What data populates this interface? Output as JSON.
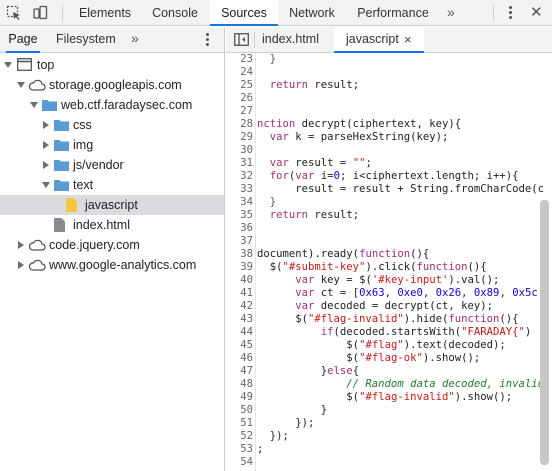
{
  "toolbar": {
    "tabs": [
      "Elements",
      "Console",
      "Sources",
      "Network",
      "Performance"
    ],
    "active_tab": "Sources",
    "more": "»"
  },
  "navigator": {
    "tabs": [
      "Page",
      "Filesystem"
    ],
    "active_tab": "Page",
    "more": "»",
    "tree": [
      {
        "label": "top"
      },
      {
        "label": "storage.googleapis.com"
      },
      {
        "label": "web.ctf.faradaysec.com"
      },
      {
        "label": "css"
      },
      {
        "label": "img"
      },
      {
        "label": "js/vendor"
      },
      {
        "label": "text"
      },
      {
        "label": "javascript"
      },
      {
        "label": "index.html"
      },
      {
        "label": "code.jquery.com"
      },
      {
        "label": "www.google-analytics.com"
      }
    ]
  },
  "editor": {
    "tabs": [
      {
        "label": "index.html"
      },
      {
        "label": "javascript",
        "close": "×"
      }
    ],
    "active_tab": "javascript",
    "line_numbers": [
      "23",
      "24",
      "25",
      "26",
      "27",
      "28",
      "29",
      "30",
      "31",
      "32",
      "33",
      "34",
      "35",
      "36",
      "37",
      "38",
      "39",
      "40",
      "41",
      "42",
      "43",
      "44",
      "45",
      "46",
      "47",
      "48",
      "49",
      "50",
      "51",
      "52",
      "53",
      "54"
    ]
  },
  "colors": {
    "accent": "#1a73e8",
    "keyword": "#a0306f",
    "string": "#c41a16",
    "number": "#1c00cf",
    "comment": "#237b32"
  }
}
